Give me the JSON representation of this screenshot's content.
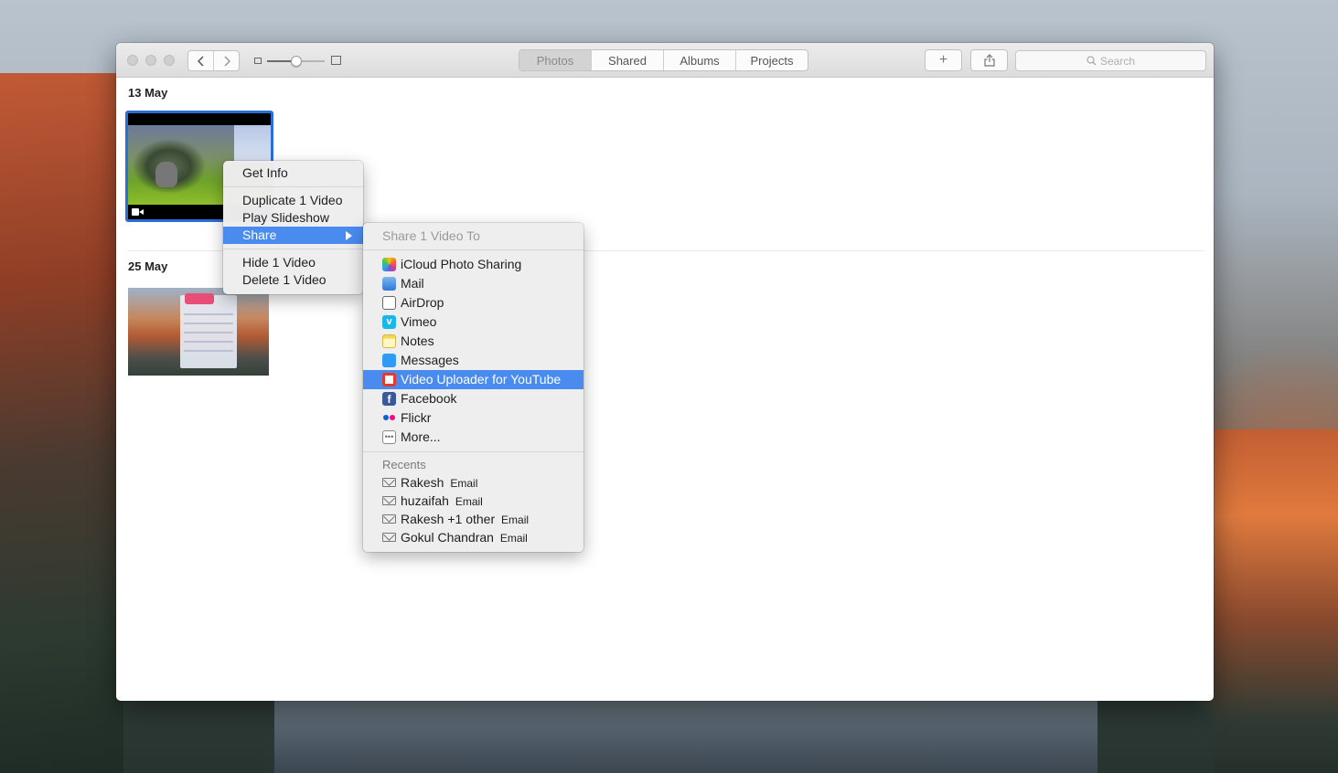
{
  "toolbar": {
    "tabs": [
      {
        "label": "Photos",
        "active": true
      },
      {
        "label": "Shared",
        "active": false
      },
      {
        "label": "Albums",
        "active": false
      },
      {
        "label": "Projects",
        "active": false
      }
    ],
    "search_placeholder": "Search",
    "add_label": "+"
  },
  "sections": [
    {
      "date": "13 May"
    },
    {
      "date": "25 May"
    }
  ],
  "context_menu": {
    "items": [
      {
        "label": "Get Info"
      },
      {
        "label": "Duplicate 1 Video"
      },
      {
        "label": "Play Slideshow"
      },
      {
        "label": "Share",
        "selected": true,
        "has_submenu": true
      },
      {
        "label": "Hide 1 Video"
      },
      {
        "label": "Delete 1 Video"
      }
    ]
  },
  "share_menu": {
    "header": "Share 1 Video To",
    "items": [
      {
        "label": "iCloud Photo Sharing",
        "icon": "icloud-photo-sharing-icon"
      },
      {
        "label": "Mail",
        "icon": "mail-icon"
      },
      {
        "label": "AirDrop",
        "icon": "airdrop-icon"
      },
      {
        "label": "Vimeo",
        "icon": "vimeo-icon"
      },
      {
        "label": "Notes",
        "icon": "notes-icon"
      },
      {
        "label": "Messages",
        "icon": "messages-icon"
      },
      {
        "label": "Video Uploader for YouTube",
        "icon": "youtube-uploader-icon",
        "selected": true
      },
      {
        "label": "Facebook",
        "icon": "facebook-icon"
      },
      {
        "label": "Flickr",
        "icon": "flickr-icon"
      },
      {
        "label": "More...",
        "icon": "more-icon"
      }
    ],
    "recents_header": "Recents",
    "recents": [
      {
        "name": "Rakesh",
        "kind": "Email"
      },
      {
        "name": "huzaifah",
        "kind": "Email"
      },
      {
        "name": "Rakesh +1 other",
        "kind": "Email"
      },
      {
        "name": "Gokul Chandran",
        "kind": "Email"
      }
    ]
  },
  "colors": {
    "selection": "#4a8bf0",
    "thumbnail_border": "#2a6fd6"
  }
}
